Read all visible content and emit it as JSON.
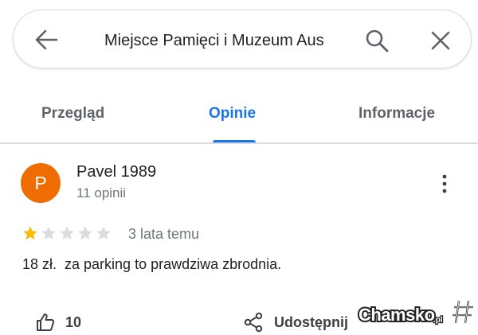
{
  "search": {
    "query": "Miejsce Pamięci i Muzeum Aus"
  },
  "tabs": [
    {
      "label": "Przegląd",
      "active": false
    },
    {
      "label": "Opinie",
      "active": true
    },
    {
      "label": "Informacje",
      "active": false
    }
  ],
  "review": {
    "avatar_letter": "P",
    "avatar_color": "#ef6c00",
    "reviewer_name": "Pavel 1989",
    "reviewer_reviews": "11 opinii",
    "rating": 1,
    "rating_max": 5,
    "date": "3 lata temu",
    "text": "18 zł.  za parking to prawdziwa zbrodnia."
  },
  "actions": {
    "like_count": "10",
    "share_label": "Udostępnij"
  },
  "watermark": {
    "text": "Chamsko.pl"
  },
  "colors": {
    "accent": "#1a73e8",
    "star_filled": "#fbbc04",
    "star_empty": "#dadce0"
  }
}
